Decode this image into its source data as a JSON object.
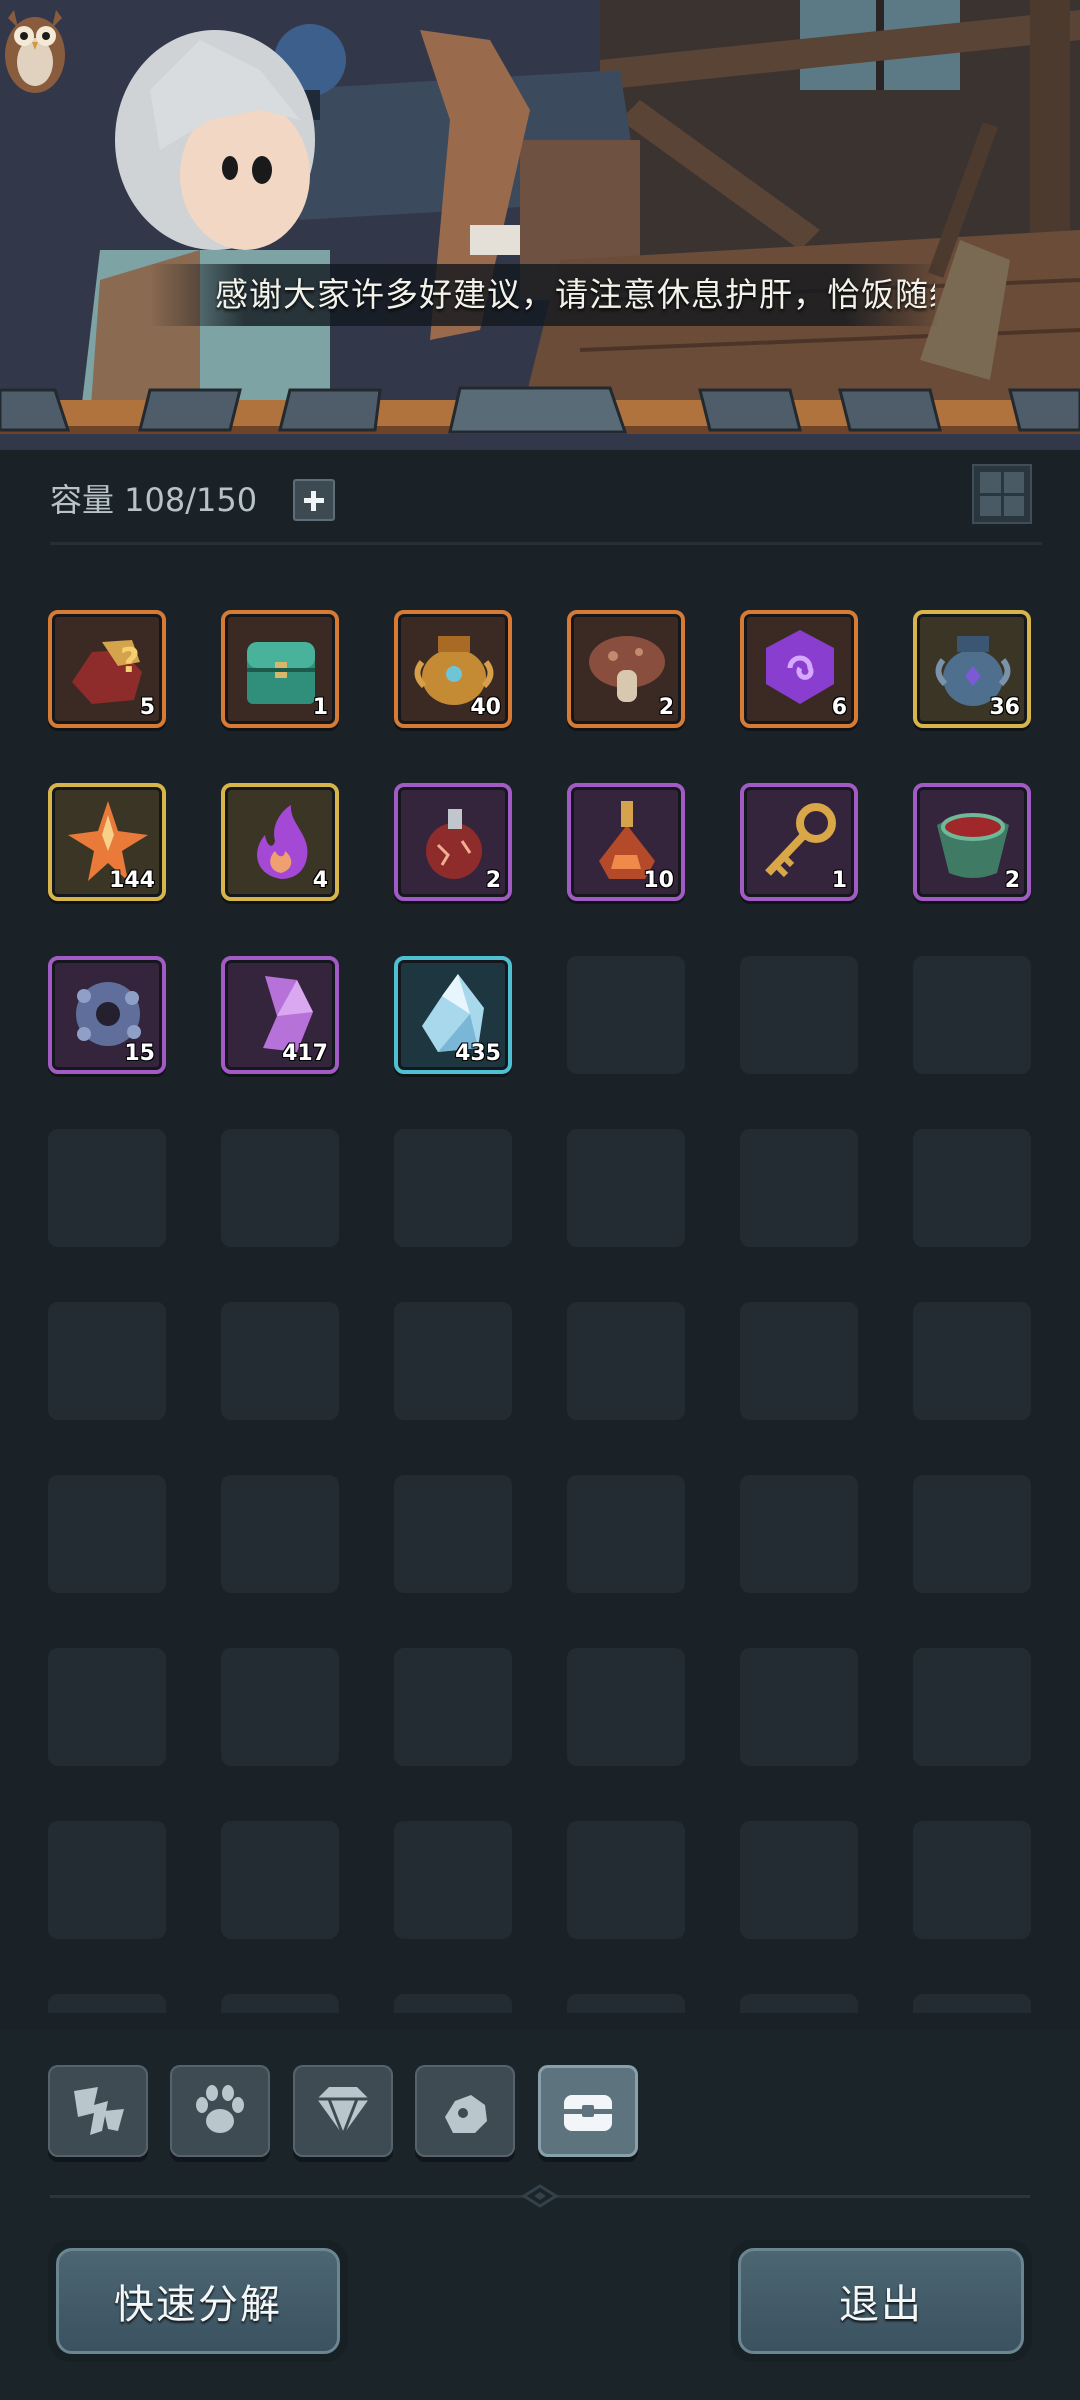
{
  "banner": {
    "subtitle": "感谢大家许多好建议，请注意休息护肝，恰饭随缘"
  },
  "header": {
    "capacity_text": "容量 108/150",
    "add_icon": "plus-icon",
    "view_toggle_icon": "grid-view-icon"
  },
  "inventory": {
    "items": [
      {
        "icon": "mystery-ore-bag-icon",
        "rarity": "orange",
        "count": "5"
      },
      {
        "icon": "treasure-chest-icon",
        "rarity": "orange",
        "count": "1"
      },
      {
        "icon": "golden-urn-icon",
        "rarity": "orange",
        "count": "40"
      },
      {
        "icon": "mushroom-icon",
        "rarity": "orange",
        "count": "2"
      },
      {
        "icon": "purple-rune-stone-icon",
        "rarity": "orange",
        "count": "6"
      },
      {
        "icon": "blue-urn-icon",
        "rarity": "gold",
        "count": "36"
      },
      {
        "icon": "star-crystal-icon",
        "rarity": "gold",
        "count": "144"
      },
      {
        "icon": "purple-flame-icon",
        "rarity": "gold",
        "count": "4"
      },
      {
        "icon": "red-potion-icon",
        "rarity": "purple",
        "count": "2"
      },
      {
        "icon": "elixir-flask-icon",
        "rarity": "purple",
        "count": "10"
      },
      {
        "icon": "golden-key-icon",
        "rarity": "purple",
        "count": "1"
      },
      {
        "icon": "blood-pot-icon",
        "rarity": "purple",
        "count": "2"
      },
      {
        "icon": "gear-ore-icon",
        "rarity": "purple",
        "count": "15"
      },
      {
        "icon": "amethyst-shard-icon",
        "rarity": "purple",
        "count": "417"
      },
      {
        "icon": "ice-crystal-icon",
        "rarity": "cyan",
        "count": "435"
      }
    ]
  },
  "tabs": [
    {
      "icon": "weapon-tab-icon",
      "active": false
    },
    {
      "icon": "paw-tab-icon",
      "active": false
    },
    {
      "icon": "gem-tab-icon",
      "active": false
    },
    {
      "icon": "ore-tab-icon",
      "active": false
    },
    {
      "icon": "chest-tab-icon",
      "active": true
    }
  ],
  "actions": {
    "decompose_label": "快速分解",
    "exit_label": "退出"
  },
  "colors": {
    "rarity_orange": "#d77b34",
    "rarity_gold": "#d7b54a",
    "rarity_purple": "#a25bc4",
    "rarity_cyan": "#4fbfd2",
    "background": "#1a2228"
  }
}
